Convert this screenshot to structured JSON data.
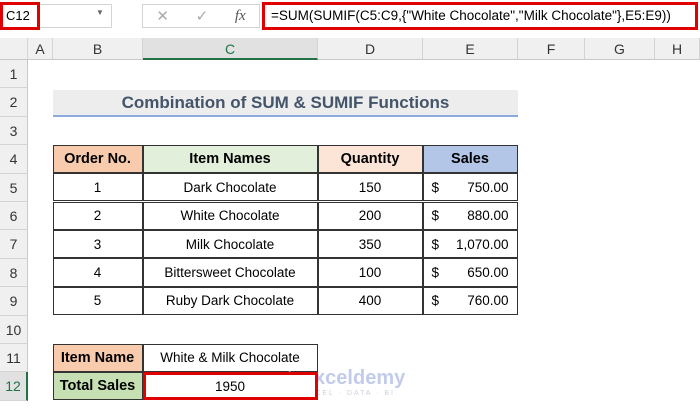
{
  "name_box": "C12",
  "formula": "=SUM(SUMIF(C5:C9,{\"White Chocolate\",\"Milk Chocolate\"},E5:E9))",
  "fx_icons": [
    "cancel-icon",
    "enter-icon",
    "fx-icon"
  ],
  "columns": [
    "A",
    "B",
    "C",
    "D",
    "E",
    "F",
    "G",
    "H"
  ],
  "rows": [
    "1",
    "2",
    "3",
    "4",
    "5",
    "6",
    "7",
    "8",
    "9",
    "10",
    "11",
    "12"
  ],
  "selected_column": "C",
  "selected_row": "12",
  "title": "Combination of SUM & SUMIF Functions",
  "table": {
    "headers": [
      "Order No.",
      "Item Names",
      "Quantity",
      "Sales"
    ],
    "header_colors": [
      "#f8cbad",
      "#e2efda",
      "#fce4d6",
      "#b4c6e7"
    ],
    "rows": [
      [
        "1",
        "Dark Chocolate",
        "150",
        "$",
        "750.00"
      ],
      [
        "2",
        "White Chocolate",
        "200",
        "$",
        "880.00"
      ],
      [
        "3",
        "Milk Chocolate",
        "350",
        "$",
        "1,070.00"
      ],
      [
        "4",
        "Bittersweet Chocolate",
        "100",
        "$",
        "650.00"
      ],
      [
        "5",
        "Ruby Dark Chocolate",
        "400",
        "$",
        "760.00"
      ]
    ]
  },
  "summary": {
    "item_label": "Item Name",
    "item_value": "White & Milk Chocolate",
    "total_label": "Total Sales",
    "total_value": "1950"
  },
  "watermark": {
    "name": "exceldemy",
    "tagline": "EXCEL · DATA · BI"
  },
  "highlight_color": "#e00000"
}
